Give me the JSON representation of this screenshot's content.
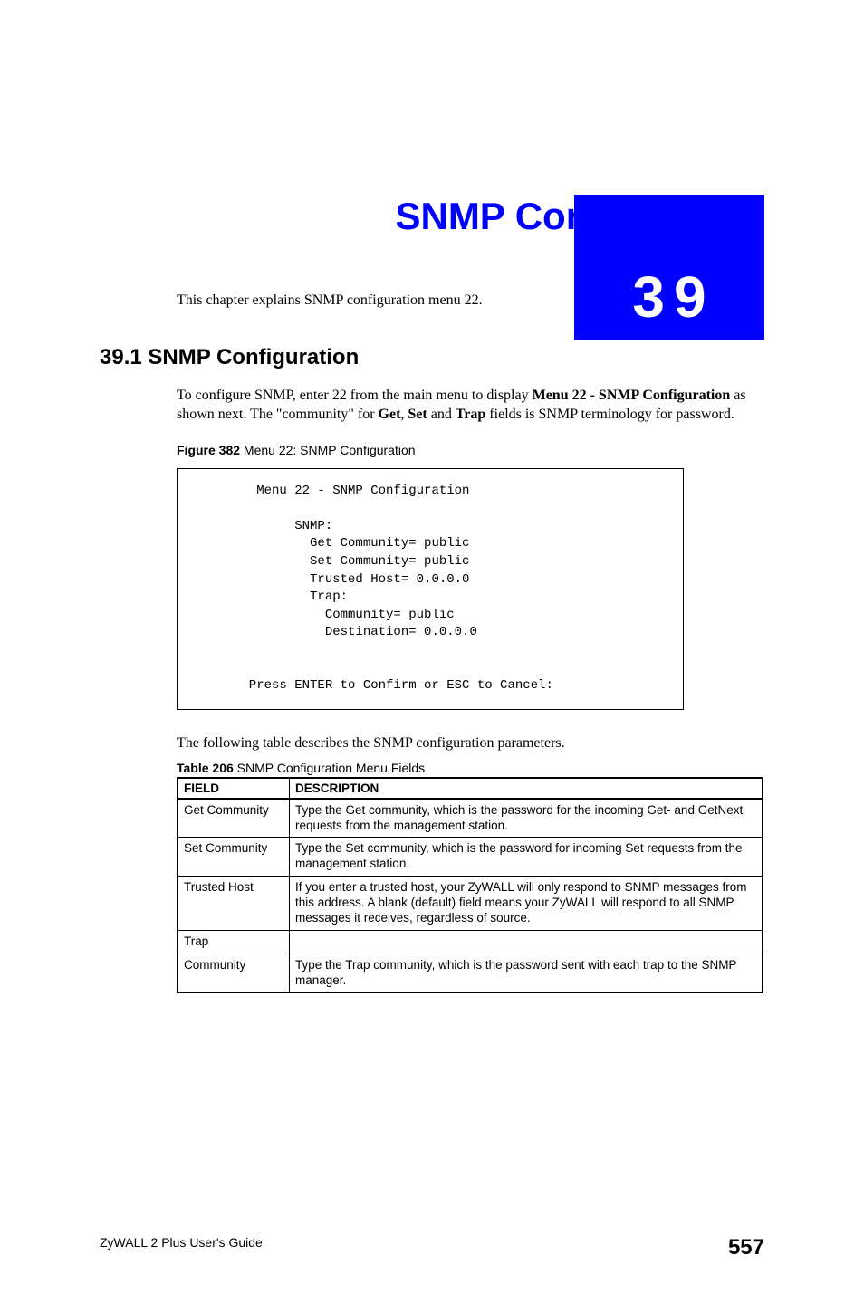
{
  "chapter": {
    "number": "39",
    "title": "SNMP Configuration",
    "intro": "This chapter explains SNMP configuration menu 22."
  },
  "section1": {
    "heading": "39.1  SNMP Configuration",
    "para_before": "To configure SNMP, enter 22 from the main menu to display ",
    "menu_bold": "Menu 22 - SNMP Configuration",
    "para_mid1": " as shown next. The \"community\" for ",
    "get_bold": "Get",
    "comma1": ", ",
    "set_bold": "Set",
    "and_text": " and ",
    "trap_bold": "Trap",
    "para_after": " fields is SNMP terminology for password."
  },
  "figure": {
    "label_bold": "Figure 382",
    "label_rest": "   Menu 22: SNMP Configuration",
    "menu_text": "        Menu 22 - SNMP Configuration\n\n             SNMP:\n               Get Community= public\n               Set Community= public\n               Trusted Host= 0.0.0.0\n               Trap:\n                 Community= public\n                 Destination= 0.0.0.0\n\n\n       Press ENTER to Confirm or ESC to Cancel:"
  },
  "table": {
    "intro": "The following table describes the SNMP configuration parameters.",
    "label_bold": "Table 206",
    "label_rest": "   SNMP Configuration Menu Fields",
    "header_field": "FIELD",
    "header_desc": "DESCRIPTION",
    "rows": [
      {
        "field": "Get Community",
        "desc": "Type the Get community, which is the password for the incoming Get- and GetNext requests from the management station."
      },
      {
        "field": "Set Community",
        "desc": "Type the Set community, which is the password for incoming Set requests from the management station."
      },
      {
        "field": "Trusted Host",
        "desc": "If you enter a trusted host, your ZyWALL will only respond to SNMP messages from this address. A blank (default) field means your ZyWALL will respond to all SNMP messages it receives, regardless of source."
      },
      {
        "field": "Trap",
        "desc": ""
      },
      {
        "field": "Community",
        "desc": "Type the Trap community, which is the password sent with each trap to the SNMP manager."
      }
    ]
  },
  "footer": {
    "guide": "ZyWALL 2 Plus User's Guide",
    "page": "557"
  }
}
